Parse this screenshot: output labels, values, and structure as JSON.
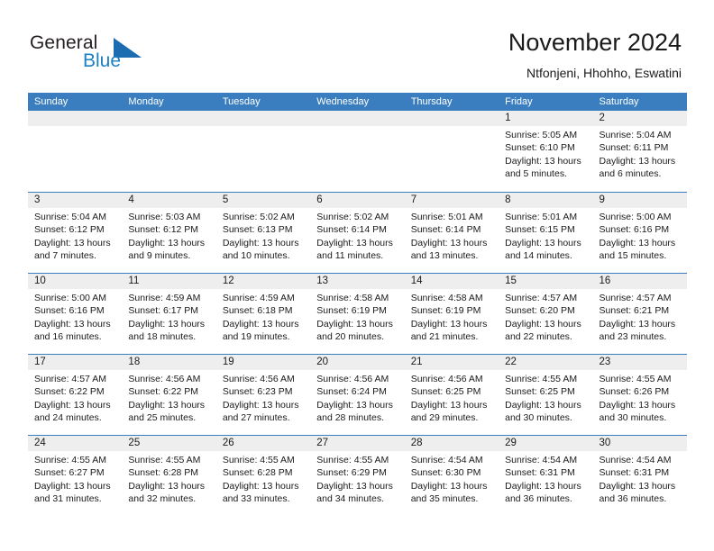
{
  "brand": {
    "name_top": "General",
    "name_bottom": "Blue",
    "accent_color": "#1b7fc4",
    "triangle_color": "#1b6cb0"
  },
  "header": {
    "title": "November 2024",
    "subtitle": "Ntfonjeni, Hhohho, Eswatini"
  },
  "theme": {
    "header_row_bg": "#3b7ebf",
    "day_band_bg": "#eeeeee",
    "row_rule": "#3b7ebf",
    "text": "#1a1a1a"
  },
  "weekdays": [
    "Sunday",
    "Monday",
    "Tuesday",
    "Wednesday",
    "Thursday",
    "Friday",
    "Saturday"
  ],
  "labels": {
    "sunrise_prefix": "Sunrise:",
    "sunset_prefix": "Sunset:",
    "daylight_prefix": "Daylight:"
  },
  "weeks": [
    [
      {
        "empty": true
      },
      {
        "empty": true
      },
      {
        "empty": true
      },
      {
        "empty": true
      },
      {
        "empty": true
      },
      {
        "day": "1",
        "sunrise": "Sunrise: 5:05 AM",
        "sunset": "Sunset: 6:10 PM",
        "daylight1": "Daylight: 13 hours",
        "daylight2": "and 5 minutes."
      },
      {
        "day": "2",
        "sunrise": "Sunrise: 5:04 AM",
        "sunset": "Sunset: 6:11 PM",
        "daylight1": "Daylight: 13 hours",
        "daylight2": "and 6 minutes."
      }
    ],
    [
      {
        "day": "3",
        "sunrise": "Sunrise: 5:04 AM",
        "sunset": "Sunset: 6:12 PM",
        "daylight1": "Daylight: 13 hours",
        "daylight2": "and 7 minutes."
      },
      {
        "day": "4",
        "sunrise": "Sunrise: 5:03 AM",
        "sunset": "Sunset: 6:12 PM",
        "daylight1": "Daylight: 13 hours",
        "daylight2": "and 9 minutes."
      },
      {
        "day": "5",
        "sunrise": "Sunrise: 5:02 AM",
        "sunset": "Sunset: 6:13 PM",
        "daylight1": "Daylight: 13 hours",
        "daylight2": "and 10 minutes."
      },
      {
        "day": "6",
        "sunrise": "Sunrise: 5:02 AM",
        "sunset": "Sunset: 6:14 PM",
        "daylight1": "Daylight: 13 hours",
        "daylight2": "and 11 minutes."
      },
      {
        "day": "7",
        "sunrise": "Sunrise: 5:01 AM",
        "sunset": "Sunset: 6:14 PM",
        "daylight1": "Daylight: 13 hours",
        "daylight2": "and 13 minutes."
      },
      {
        "day": "8",
        "sunrise": "Sunrise: 5:01 AM",
        "sunset": "Sunset: 6:15 PM",
        "daylight1": "Daylight: 13 hours",
        "daylight2": "and 14 minutes."
      },
      {
        "day": "9",
        "sunrise": "Sunrise: 5:00 AM",
        "sunset": "Sunset: 6:16 PM",
        "daylight1": "Daylight: 13 hours",
        "daylight2": "and 15 minutes."
      }
    ],
    [
      {
        "day": "10",
        "sunrise": "Sunrise: 5:00 AM",
        "sunset": "Sunset: 6:16 PM",
        "daylight1": "Daylight: 13 hours",
        "daylight2": "and 16 minutes."
      },
      {
        "day": "11",
        "sunrise": "Sunrise: 4:59 AM",
        "sunset": "Sunset: 6:17 PM",
        "daylight1": "Daylight: 13 hours",
        "daylight2": "and 18 minutes."
      },
      {
        "day": "12",
        "sunrise": "Sunrise: 4:59 AM",
        "sunset": "Sunset: 6:18 PM",
        "daylight1": "Daylight: 13 hours",
        "daylight2": "and 19 minutes."
      },
      {
        "day": "13",
        "sunrise": "Sunrise: 4:58 AM",
        "sunset": "Sunset: 6:19 PM",
        "daylight1": "Daylight: 13 hours",
        "daylight2": "and 20 minutes."
      },
      {
        "day": "14",
        "sunrise": "Sunrise: 4:58 AM",
        "sunset": "Sunset: 6:19 PM",
        "daylight1": "Daylight: 13 hours",
        "daylight2": "and 21 minutes."
      },
      {
        "day": "15",
        "sunrise": "Sunrise: 4:57 AM",
        "sunset": "Sunset: 6:20 PM",
        "daylight1": "Daylight: 13 hours",
        "daylight2": "and 22 minutes."
      },
      {
        "day": "16",
        "sunrise": "Sunrise: 4:57 AM",
        "sunset": "Sunset: 6:21 PM",
        "daylight1": "Daylight: 13 hours",
        "daylight2": "and 23 minutes."
      }
    ],
    [
      {
        "day": "17",
        "sunrise": "Sunrise: 4:57 AM",
        "sunset": "Sunset: 6:22 PM",
        "daylight1": "Daylight: 13 hours",
        "daylight2": "and 24 minutes."
      },
      {
        "day": "18",
        "sunrise": "Sunrise: 4:56 AM",
        "sunset": "Sunset: 6:22 PM",
        "daylight1": "Daylight: 13 hours",
        "daylight2": "and 25 minutes."
      },
      {
        "day": "19",
        "sunrise": "Sunrise: 4:56 AM",
        "sunset": "Sunset: 6:23 PM",
        "daylight1": "Daylight: 13 hours",
        "daylight2": "and 27 minutes."
      },
      {
        "day": "20",
        "sunrise": "Sunrise: 4:56 AM",
        "sunset": "Sunset: 6:24 PM",
        "daylight1": "Daylight: 13 hours",
        "daylight2": "and 28 minutes."
      },
      {
        "day": "21",
        "sunrise": "Sunrise: 4:56 AM",
        "sunset": "Sunset: 6:25 PM",
        "daylight1": "Daylight: 13 hours",
        "daylight2": "and 29 minutes."
      },
      {
        "day": "22",
        "sunrise": "Sunrise: 4:55 AM",
        "sunset": "Sunset: 6:25 PM",
        "daylight1": "Daylight: 13 hours",
        "daylight2": "and 30 minutes."
      },
      {
        "day": "23",
        "sunrise": "Sunrise: 4:55 AM",
        "sunset": "Sunset: 6:26 PM",
        "daylight1": "Daylight: 13 hours",
        "daylight2": "and 30 minutes."
      }
    ],
    [
      {
        "day": "24",
        "sunrise": "Sunrise: 4:55 AM",
        "sunset": "Sunset: 6:27 PM",
        "daylight1": "Daylight: 13 hours",
        "daylight2": "and 31 minutes."
      },
      {
        "day": "25",
        "sunrise": "Sunrise: 4:55 AM",
        "sunset": "Sunset: 6:28 PM",
        "daylight1": "Daylight: 13 hours",
        "daylight2": "and 32 minutes."
      },
      {
        "day": "26",
        "sunrise": "Sunrise: 4:55 AM",
        "sunset": "Sunset: 6:28 PM",
        "daylight1": "Daylight: 13 hours",
        "daylight2": "and 33 minutes."
      },
      {
        "day": "27",
        "sunrise": "Sunrise: 4:55 AM",
        "sunset": "Sunset: 6:29 PM",
        "daylight1": "Daylight: 13 hours",
        "daylight2": "and 34 minutes."
      },
      {
        "day": "28",
        "sunrise": "Sunrise: 4:54 AM",
        "sunset": "Sunset: 6:30 PM",
        "daylight1": "Daylight: 13 hours",
        "daylight2": "and 35 minutes."
      },
      {
        "day": "29",
        "sunrise": "Sunrise: 4:54 AM",
        "sunset": "Sunset: 6:31 PM",
        "daylight1": "Daylight: 13 hours",
        "daylight2": "and 36 minutes."
      },
      {
        "day": "30",
        "sunrise": "Sunrise: 4:54 AM",
        "sunset": "Sunset: 6:31 PM",
        "daylight1": "Daylight: 13 hours",
        "daylight2": "and 36 minutes."
      }
    ]
  ]
}
